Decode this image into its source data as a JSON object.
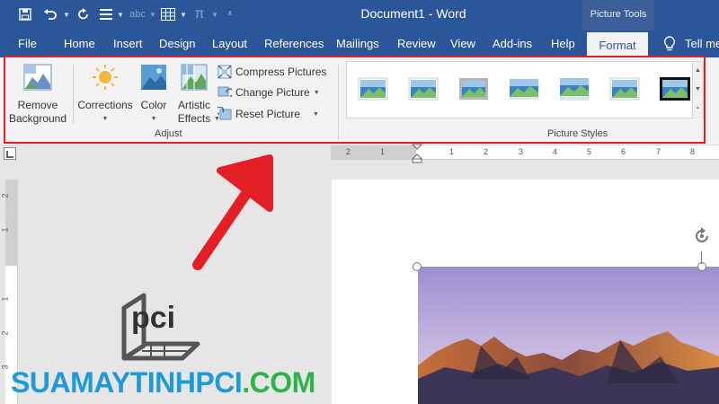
{
  "window": {
    "title": "Document1  -  Word",
    "contextual_tab_group": "Picture Tools"
  },
  "quick_access": {
    "icons": [
      "save-icon",
      "undo-icon",
      "redo-icon",
      "list-icon",
      "spelling-icon",
      "table-icon",
      "equation-icon",
      "customize-icon"
    ]
  },
  "tabs": [
    "File",
    "Home",
    "Insert",
    "Design",
    "Layout",
    "References",
    "Mailings",
    "Review",
    "View",
    "Add-ins",
    "Help",
    "Format"
  ],
  "tell_me": "Tell me",
  "ribbon": {
    "adjust": {
      "remove_background": "Remove\nBackground",
      "corrections": "Corrections",
      "color": "Color",
      "artistic_effects": "Artistic\nEffects",
      "compress_pictures": "Compress Pictures",
      "change_picture": "Change Picture",
      "reset_picture": "Reset Picture",
      "label": "Adjust"
    },
    "picture_styles": {
      "label": "Picture Styles",
      "count": 7
    }
  },
  "ruler": {
    "numbers": [
      "2",
      "1",
      "1",
      "2",
      "3",
      "4",
      "5",
      "6",
      "7",
      "8"
    ]
  },
  "vertical_ruler": {
    "numbers": [
      "2",
      "1",
      "1",
      "2",
      "3"
    ]
  },
  "watermark": {
    "text_part1": "SUAMAYTINHPCI",
    "text_part2": ".COM",
    "logo": "pci"
  },
  "colors": {
    "word_blue": "#2b579a",
    "highlight_red": "#e31e24",
    "watermark_blue": "#1e9bd7",
    "watermark_green": "#2db34a"
  }
}
